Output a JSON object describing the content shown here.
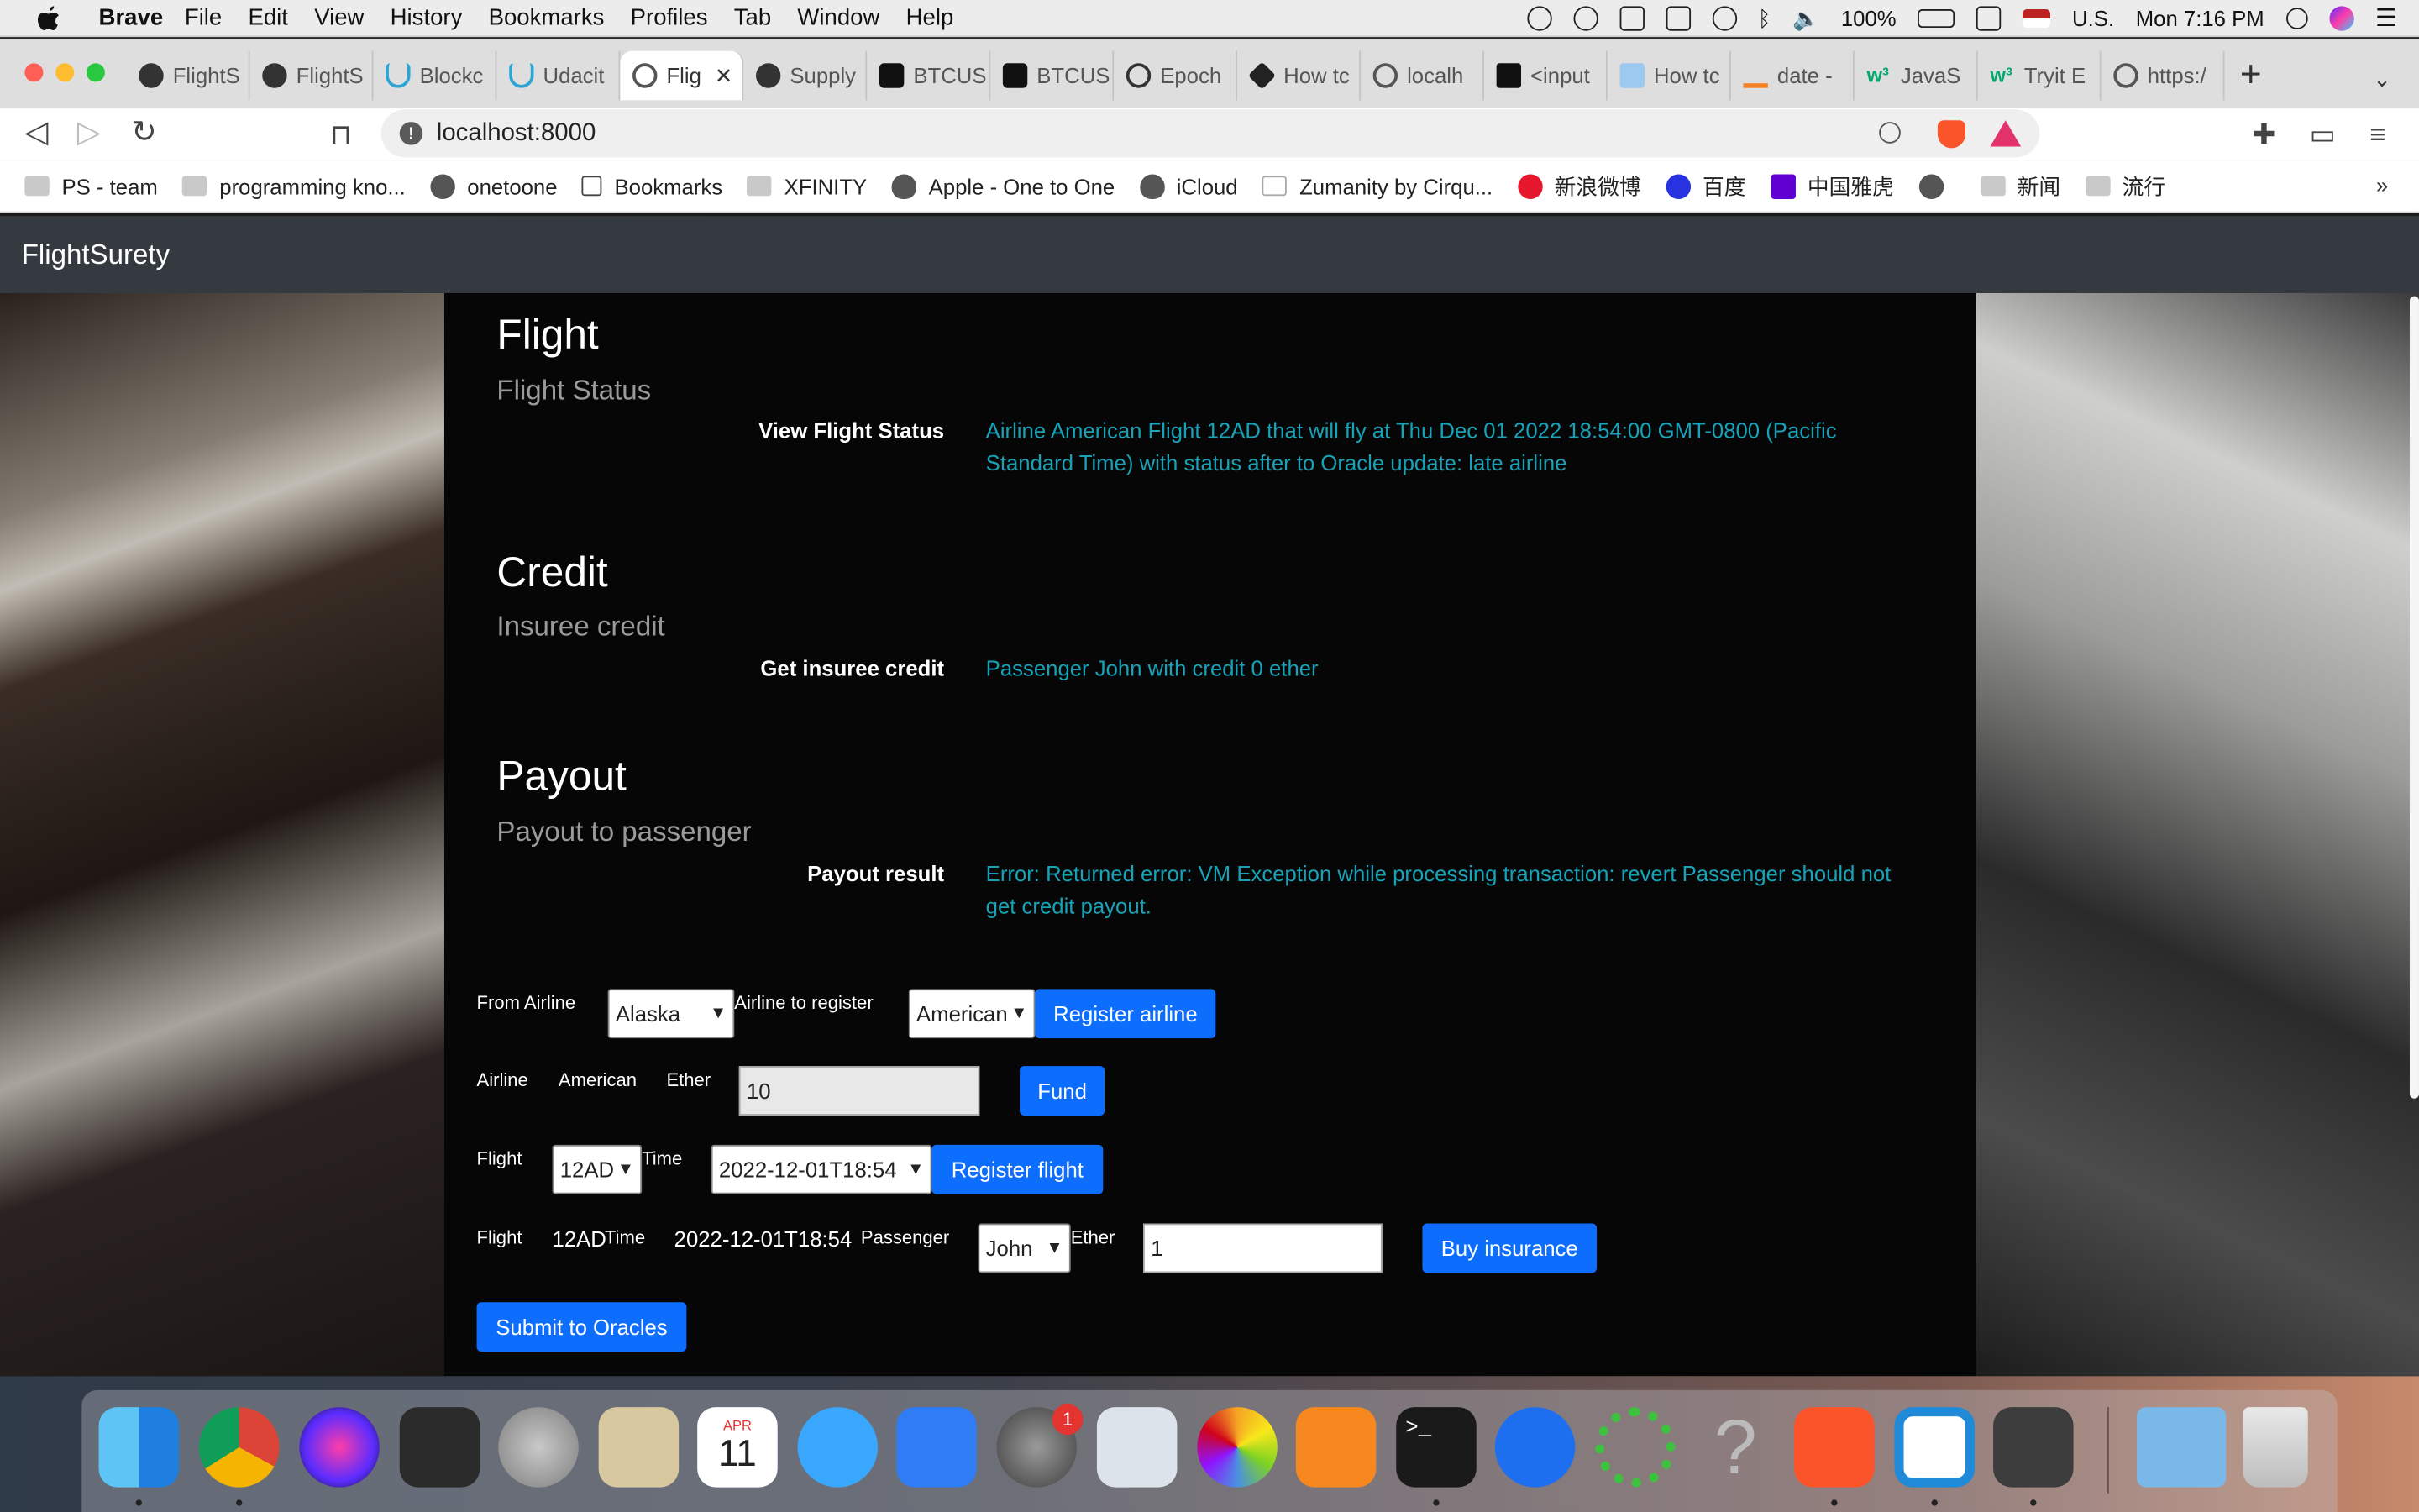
{
  "menubar": {
    "app": "Brave",
    "items": [
      "File",
      "Edit",
      "View",
      "History",
      "Bookmarks",
      "Profiles",
      "Tab",
      "Window",
      "Help"
    ],
    "battery": "100%",
    "input_source": "U.S.",
    "clock": "Mon 7:16 PM"
  },
  "tabs": [
    {
      "label": "FlightS",
      "icon": "github-icon"
    },
    {
      "label": "FlightS",
      "icon": "github-icon"
    },
    {
      "label": "Blockc",
      "icon": "udacity-icon"
    },
    {
      "label": "Udacit",
      "icon": "udacity-icon"
    },
    {
      "label": "Flig",
      "icon": "globe-icon",
      "active": true
    },
    {
      "label": "Supply",
      "icon": "github-icon"
    },
    {
      "label": "BTCUS",
      "icon": "tradingview-icon"
    },
    {
      "label": "BTCUS",
      "icon": "tradingview-icon"
    },
    {
      "label": "Epoch",
      "icon": "clock-icon"
    },
    {
      "label": "How tc",
      "icon": "hexagon-icon"
    },
    {
      "label": "localh",
      "icon": "globe-icon"
    },
    {
      "label": "<input",
      "icon": "mdn-icon"
    },
    {
      "label": "How tc",
      "icon": "code-icon"
    },
    {
      "label": "date -",
      "icon": "stackoverflow-icon"
    },
    {
      "label": "JavaS",
      "icon": "w3schools-icon"
    },
    {
      "label": "Tryit E",
      "icon": "w3schools-icon"
    },
    {
      "label": "https:/",
      "icon": "globe-icon"
    }
  ],
  "toolbar": {
    "url": "localhost:8000"
  },
  "bookmarks": [
    {
      "label": "PS - team",
      "icon": "folder-icon"
    },
    {
      "label": "programming kno...",
      "icon": "folder-icon"
    },
    {
      "label": "onetoone",
      "icon": "globe-icon"
    },
    {
      "label": "Bookmarks",
      "icon": "bookmark-icon"
    },
    {
      "label": "XFINITY",
      "icon": "folder-icon"
    },
    {
      "label": "Apple - One to One",
      "icon": "apple-icon"
    },
    {
      "label": "iCloud",
      "icon": "apple-icon"
    },
    {
      "label": "Zumanity by Cirqu...",
      "icon": "tw-icon"
    },
    {
      "label": "新浪微博",
      "icon": "weibo-icon"
    },
    {
      "label": "百度",
      "icon": "baidu-icon"
    },
    {
      "label": "中国雅虎",
      "icon": "yahoo-icon"
    },
    {
      "label": "",
      "icon": "globe-icon"
    },
    {
      "label": "新闻",
      "icon": "folder-icon"
    },
    {
      "label": "流行",
      "icon": "folder-icon"
    }
  ],
  "page": {
    "brand": "FlightSurety",
    "flight": {
      "title": "Flight",
      "subtitle": "Flight Status",
      "label": "View Flight Status",
      "value": "Airline American Flight 12AD that will fly at Thu Dec 01 2022 18:54:00 GMT-0800 (Pacific Standard Time) with status after to Oracle update: late airline"
    },
    "credit": {
      "title": "Credit",
      "subtitle": "Insuree credit",
      "label": "Get insuree credit",
      "value": "Passenger John with credit 0 ether"
    },
    "payout": {
      "title": "Payout",
      "subtitle": "Payout to passenger",
      "label": "Payout result",
      "value": "Error: Returned error: VM Exception while processing transaction: revert Passenger should not get credit payout."
    },
    "form": {
      "from_airline_label": "From Airline",
      "from_airline_value": "Alaska",
      "airline_to_register_label": "Airline to register",
      "airline_to_register_value": "American",
      "register_airline_button": "Register airline",
      "fund_airline_label": "Airline",
      "fund_airline_value": "American",
      "fund_ether_label": "Ether",
      "fund_ether_value": "10",
      "fund_button": "Fund",
      "flight_label": "Flight",
      "flight_value": "12AD",
      "time_label": "Time",
      "time_value": "2022-12-01T18:54",
      "register_flight_button": "Register flight",
      "buy_flight_label": "Flight",
      "buy_flight_value": "12AD",
      "buy_time_label": "Time",
      "buy_time_value": "2022-12-01T18:54",
      "passenger_label": "Passenger",
      "passenger_value": "John",
      "buy_ether_label": "Ether",
      "buy_ether_value": "1",
      "buy_insurance_button": "Buy insurance",
      "submit_oracles_button": "Submit to Oracles"
    }
  },
  "dock": {
    "apps": [
      "Finder",
      "Chrome",
      "Siri",
      "Mission Control",
      "Launchpad",
      "Mail",
      "Calendar",
      "Messages",
      "Keynote",
      "System Preferences",
      "Preview",
      "Photos",
      "Books",
      "Terminal",
      "Sourcetree",
      "Activity",
      "Help",
      "Brave",
      "VS Code",
      "Sublime Text",
      "Applications",
      "Trash"
    ],
    "calendar_month": "APR",
    "calendar_day": "11",
    "sysprefs_badge": "1"
  }
}
